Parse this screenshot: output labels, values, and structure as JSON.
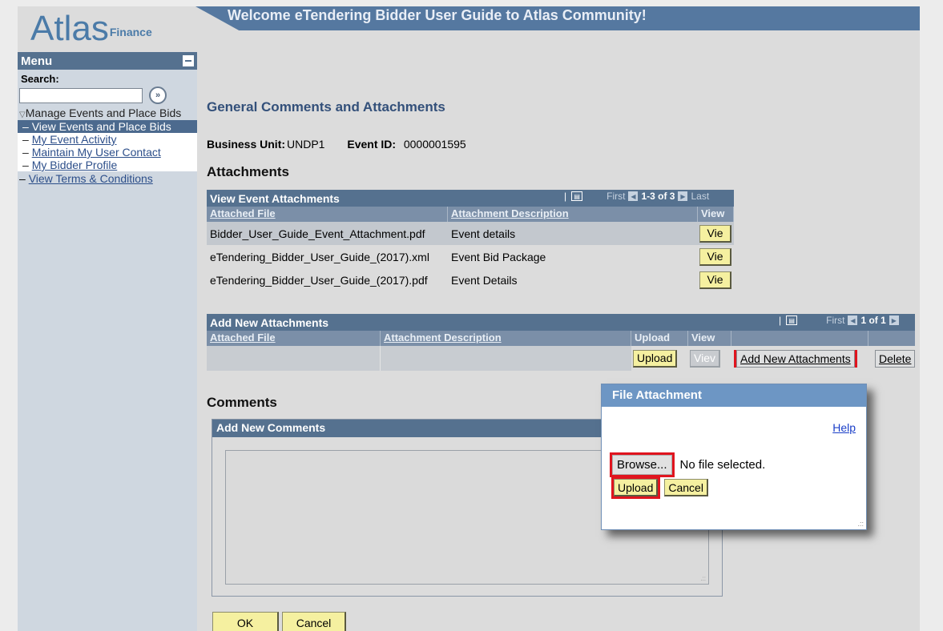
{
  "header": {
    "logo_main": "Atlas",
    "logo_sub": "Finance",
    "banner": "Welcome eTendering Bidder User Guide to Atlas Community!"
  },
  "menu": {
    "title": "Menu",
    "search_label": "Search:",
    "group": "Manage Events and Place Bids",
    "items": [
      {
        "label": "View Events and Place Bids"
      },
      {
        "label": "My Event Activity"
      },
      {
        "label": "Maintain My User Contact"
      },
      {
        "label": "My Bidder Profile"
      }
    ],
    "extra": "View Terms & Conditions"
  },
  "page": {
    "title": "General Comments and Attachments",
    "business_unit_label": "Business Unit:",
    "business_unit_value": "UNDP1",
    "event_id_label": "Event ID:",
    "event_id_value": "0000001595",
    "attachments_title": "Attachments",
    "comments_title": "Comments"
  },
  "view_attachments": {
    "title": "View Event Attachments",
    "nav_first": "First",
    "nav_range": "1-3 of 3",
    "nav_last": "Last",
    "columns": [
      "Attached File",
      "Attachment Description",
      "View"
    ],
    "rows": [
      {
        "file": "Bidder_User_Guide_Event_Attachment.pdf",
        "description": "Event details",
        "view": "Vie"
      },
      {
        "file": "eTendering_Bidder_User_Guide_(2017).xml",
        "description": "Event Bid Package",
        "view": "Vie"
      },
      {
        "file": "eTendering_Bidder_User_Guide_(2017).pdf",
        "description": "Event Details",
        "view": "Vie"
      }
    ]
  },
  "new_attachments": {
    "title": "Add New Attachments",
    "nav_first": "First",
    "nav_range": "1 of 1",
    "columns": [
      "Attached File",
      "Attachment Description",
      "Upload",
      "View"
    ],
    "upload_label": "Upload",
    "view_label": "Viev",
    "add_label": "Add New Attachments",
    "delete_label": "Delete"
  },
  "comments": {
    "head": "Add New Comments",
    "value": ""
  },
  "modal": {
    "title": "File Attachment",
    "help": "Help",
    "browse": "Browse...",
    "no_file": "No file selected.",
    "upload": "Upload",
    "cancel": "Cancel"
  },
  "footer": {
    "ok": "OK",
    "cancel": "Cancel"
  },
  "colors": {
    "header_blue": "#55718f",
    "button_yellow": "#f5f0a0",
    "highlight_red": "#e0141e",
    "modal_title": "#6d96c4"
  }
}
